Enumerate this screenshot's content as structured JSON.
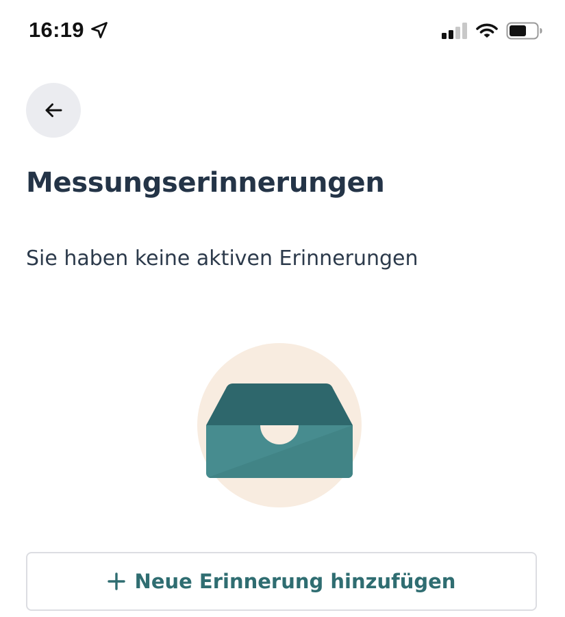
{
  "status_bar": {
    "time": "16:19",
    "icons": [
      "location-arrow-icon",
      "cellular-signal-icon",
      "wifi-icon",
      "battery-icon"
    ]
  },
  "header": {
    "back_icon": "arrow-left-icon",
    "title": "Messungserinnerungen"
  },
  "main": {
    "empty_message": "Sie haben keine aktiven Erinnerungen",
    "illustration_icon": "empty-inbox-tray-icon"
  },
  "actions": {
    "add_reminder_label": "Neue Erinnerung hinzufügen",
    "add_icon": "plus-icon"
  },
  "colors": {
    "title": "#243447",
    "accent": "#2f6d71",
    "tray_dark": "#2e676c",
    "tray_light": "#478c8f",
    "circle_bg": "#f8ece0",
    "back_button_bg": "#ebecf0",
    "button_border": "#dcdde2"
  }
}
